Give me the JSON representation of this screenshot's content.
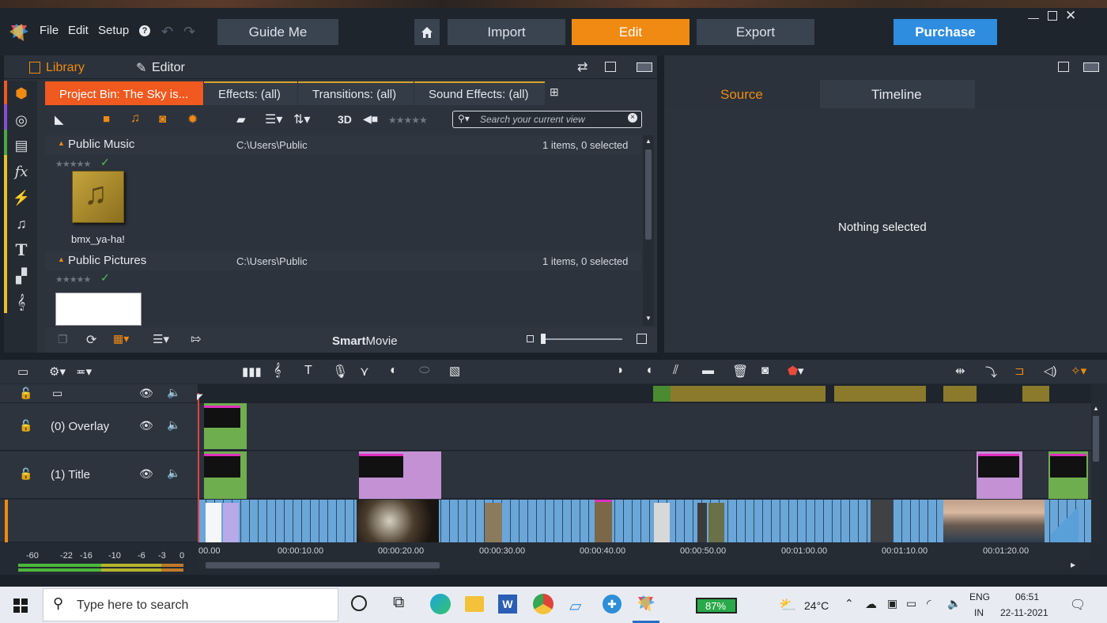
{
  "menu": {
    "file": "File",
    "edit": "Edit",
    "setup": "Setup",
    "help": "?"
  },
  "top_buttons": {
    "guide": "Guide Me",
    "import": "Import",
    "edit": "Edit",
    "export": "Export",
    "purchase": "Purchase"
  },
  "panel_tabs": {
    "library": "Library",
    "editor": "Editor"
  },
  "bin_tabs": [
    {
      "label": "Project Bin: The Sky is..."
    },
    {
      "label": "Effects: (all)"
    },
    {
      "label": "Transitions: (all)"
    },
    {
      "label": "Sound Effects: (all)"
    }
  ],
  "toolbar": {
    "mode_3d": "3D",
    "search_placeholder": "Search your current view"
  },
  "groups": [
    {
      "name": "Public Music",
      "path": "C:\\Users\\Public",
      "count": "1 items, 0 selected",
      "item": "bmx_ya-ha!"
    },
    {
      "name": "Public Pictures",
      "path": "C:\\Users\\Public",
      "count": "1 items, 0 selected"
    }
  ],
  "smartmovie": {
    "bold": "Smart",
    "rest": "Movie"
  },
  "source_tabs": {
    "source": "Source",
    "timeline": "Timeline"
  },
  "source_empty": "Nothing selected",
  "tracks": [
    {
      "label": "(0) Overlay"
    },
    {
      "label": "(1) Title"
    }
  ],
  "ruler": [
    "00.00",
    "00:00:10.00",
    "00:00:20.00",
    "00:00:30.00",
    "00:00:40.00",
    "00:00:50.00",
    "00:01:00.00",
    "00:01:10.00",
    "00:01:20.00"
  ],
  "meter_scale": [
    "-60",
    "-22",
    "-16",
    "-10",
    "-6",
    "-3",
    "0"
  ],
  "taskbar": {
    "search": "Type here to search",
    "battery": "87%",
    "temp": "24°C",
    "lang1": "ENG",
    "lang2": "IN",
    "time": "06:51",
    "date": "22-11-2021"
  },
  "colors": {
    "accent_orange": "#f08a12",
    "purchase_blue": "#2f8de0",
    "bin_active": "#f0591f",
    "video_track": "#6aa6d8",
    "title_clip": "#c391d4",
    "overlay_green": "#6fae4f"
  }
}
